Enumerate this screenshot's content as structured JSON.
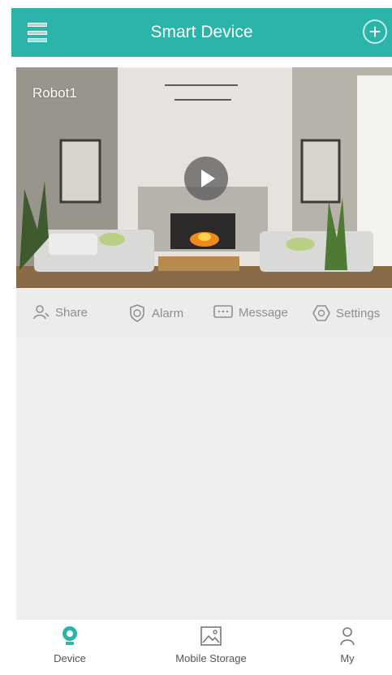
{
  "header": {
    "title": "Smart Device"
  },
  "camera": {
    "name": "Robot1"
  },
  "actions": [
    {
      "label": "Share"
    },
    {
      "label": "Alarm"
    },
    {
      "label": "Message"
    },
    {
      "label": "Settings"
    }
  ],
  "tabs": [
    {
      "label": "Device",
      "active": true
    },
    {
      "label": "Mobile Storage",
      "active": false
    },
    {
      "label": "My",
      "active": false
    }
  ],
  "colors": {
    "accent": "#2bb4aa",
    "panel": "#eeeeee",
    "muted_text": "#8e8e8e"
  }
}
